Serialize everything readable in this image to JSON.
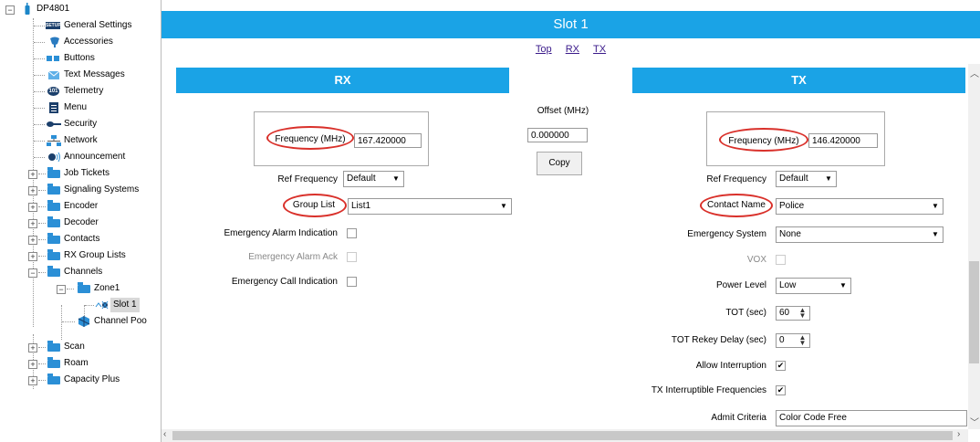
{
  "tree": {
    "root": "DP4801",
    "items": [
      {
        "label": "General Settings",
        "icon": "settings-icon"
      },
      {
        "label": "Accessories",
        "icon": "accessories-icon"
      },
      {
        "label": "Buttons",
        "icon": "buttons-icon"
      },
      {
        "label": "Text Messages",
        "icon": "text-messages-icon"
      },
      {
        "label": "Telemetry",
        "icon": "telemetry-icon"
      },
      {
        "label": "Menu",
        "icon": "menu-icon"
      },
      {
        "label": "Security",
        "icon": "key-icon"
      },
      {
        "label": "Network",
        "icon": "network-icon"
      },
      {
        "label": "Announcement",
        "icon": "speaker-icon"
      },
      {
        "label": "Job Tickets",
        "icon": "folder-icon"
      },
      {
        "label": "Signaling Systems",
        "icon": "folder-icon"
      },
      {
        "label": "Encoder",
        "icon": "folder-icon"
      },
      {
        "label": "Decoder",
        "icon": "folder-icon"
      },
      {
        "label": "Contacts",
        "icon": "folder-icon"
      },
      {
        "label": "RX Group Lists",
        "icon": "folder-icon"
      },
      {
        "label": "Channels",
        "icon": "folder-icon"
      },
      {
        "label": "Zone1",
        "icon": "folder-icon"
      },
      {
        "label": "Slot 1",
        "icon": "channel-icon"
      },
      {
        "label": "Channel Poo",
        "icon": "channel-pool-icon"
      },
      {
        "label": "Scan",
        "icon": "folder-icon"
      },
      {
        "label": "Roam",
        "icon": "folder-icon"
      },
      {
        "label": "Capacity Plus",
        "icon": "folder-icon"
      }
    ]
  },
  "header": {
    "title": "Slot 1"
  },
  "anchors": [
    "Top",
    "RX",
    "TX"
  ],
  "rx": {
    "title": "RX",
    "frequency_label": "Frequency (MHz)",
    "frequency_value": "167.420000",
    "ref_frequency_label": "Ref Frequency",
    "ref_frequency_value": "Default",
    "group_list_label": "Group List",
    "group_list_value": "List1",
    "emergency_alarm_indication_label": "Emergency Alarm Indication",
    "emergency_alarm_ack_label": "Emergency Alarm Ack",
    "emergency_call_indication_label": "Emergency Call Indication"
  },
  "offset": {
    "label": "Offset (MHz)",
    "value": "0.000000",
    "copy_label": "Copy"
  },
  "tx": {
    "title": "TX",
    "frequency_label": "Frequency (MHz)",
    "frequency_value": "146.420000",
    "ref_frequency_label": "Ref Frequency",
    "ref_frequency_value": "Default",
    "contact_name_label": "Contact Name",
    "contact_name_value": "Police",
    "emergency_system_label": "Emergency System",
    "emergency_system_value": "None",
    "vox_label": "VOX",
    "power_level_label": "Power Level",
    "power_level_value": "Low",
    "tot_label": "TOT (sec)",
    "tot_value": "60",
    "tot_rekey_label": "TOT Rekey Delay (sec)",
    "tot_rekey_value": "0",
    "allow_interruption_label": "Allow Interruption",
    "allow_interruption_checked": true,
    "tx_interruptible_label": "TX Interruptible Frequencies",
    "tx_interruptible_checked": true,
    "admit_criteria_label": "Admit Criteria",
    "admit_criteria_value": "Color Code Free"
  },
  "colors": {
    "header_blue": "#1aa3e6",
    "highlight_red": "#d9302a",
    "link_purple": "#3a1a8a"
  }
}
